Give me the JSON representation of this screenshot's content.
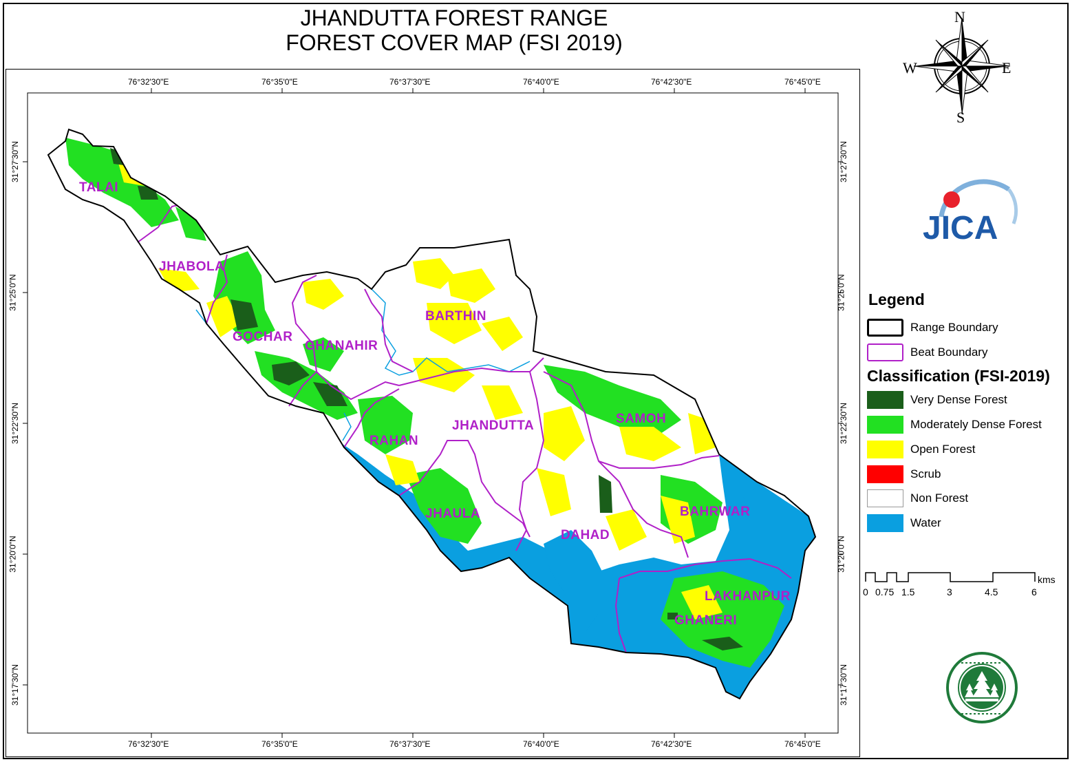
{
  "title": {
    "line1": "JHANDUTTA FOREST RANGE",
    "line2": "FOREST COVER MAP (FSI 2019)"
  },
  "graticule": {
    "longitudes": [
      "76°32'30\"E",
      "76°35'0\"E",
      "76°37'30\"E",
      "76°40'0\"E",
      "76°42'30\"E",
      "76°45'0\"E"
    ],
    "latitudes": [
      "31°27'30\"N",
      "31°25'0\"N",
      "31°22'30\"N",
      "31°20'0\"N",
      "31°17'30\"N"
    ]
  },
  "beats": [
    "TALAI",
    "JHABOLA",
    "GOCHAR",
    "GHANAHIR",
    "BARTHIN",
    "RAHAN",
    "JHANDUTTA",
    "SAMOH",
    "JHAULA",
    "DAHAD",
    "BAHRWAR",
    "LAKHANPUR",
    "GHANERI"
  ],
  "compass": {
    "n": "N",
    "s": "S",
    "e": "E",
    "w": "W"
  },
  "logos": {
    "jica": "JICA"
  },
  "legend": {
    "title": "Legend",
    "boundaries": [
      {
        "label": "Range Boundary",
        "color": "#000000"
      },
      {
        "label": "Beat Boundary",
        "color": "#b020c8"
      }
    ],
    "classification_title": "Classification (FSI-2019)",
    "classes": [
      {
        "label": "Very Dense Forest",
        "color": "#1a5e1a"
      },
      {
        "label": "Moderately Dense Forest",
        "color": "#22e022"
      },
      {
        "label": "Open Forest",
        "color": "#ffff00"
      },
      {
        "label": "Scrub",
        "color": "#ff0000"
      },
      {
        "label": "Non Forest",
        "color": "#ffffff"
      },
      {
        "label": "Water",
        "color": "#0a9fe0"
      }
    ]
  },
  "scale_bar": {
    "labels": [
      "0",
      "0.75",
      "1.5",
      "3",
      "4.5",
      "6"
    ],
    "unit": "kms"
  }
}
